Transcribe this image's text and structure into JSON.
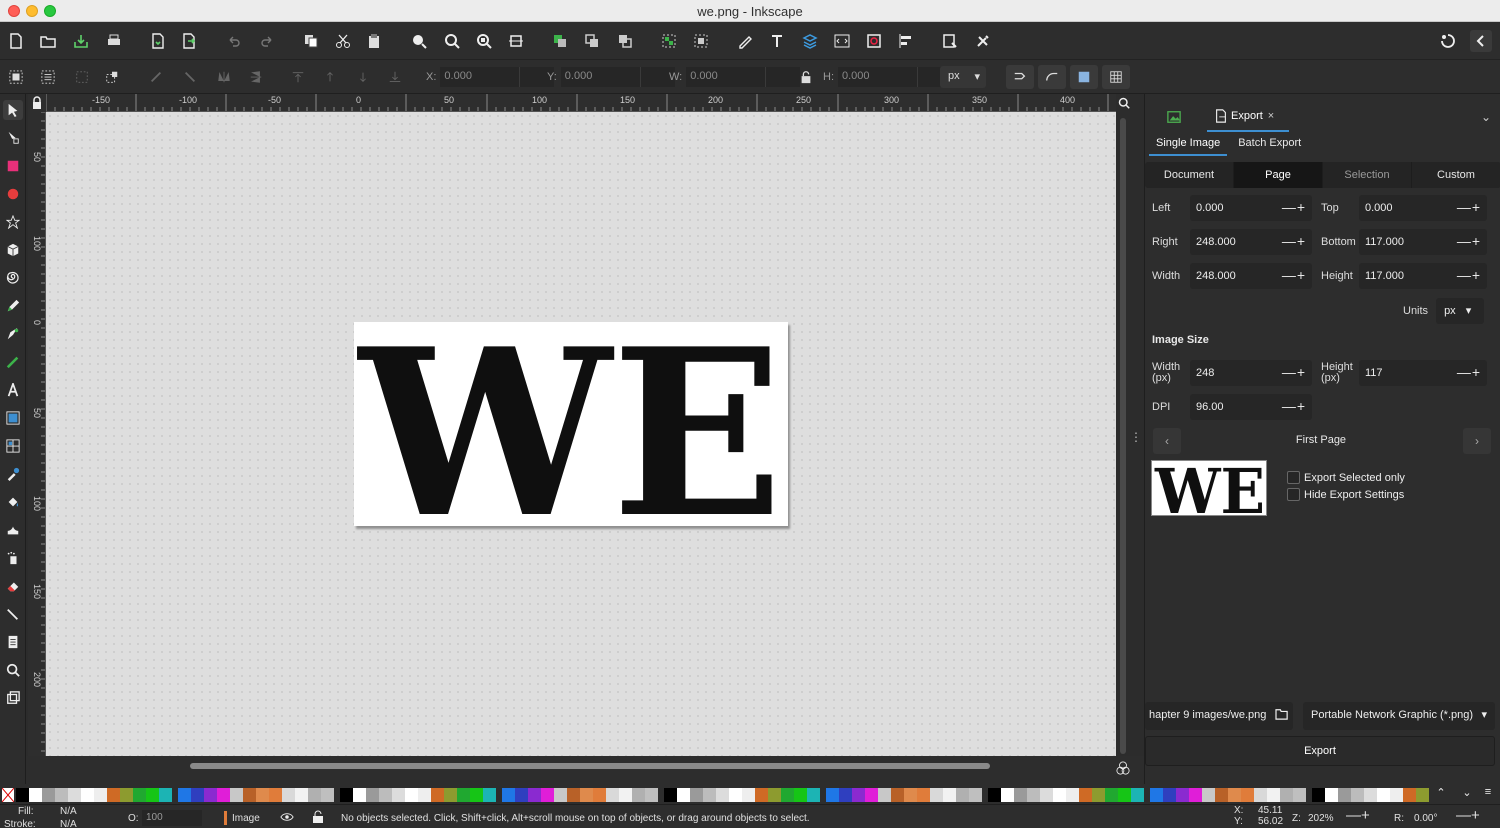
{
  "window": {
    "title": "we.png - Inkscape"
  },
  "toolbar": {
    "icons": [
      "new-document-icon",
      "open-icon",
      "save-icon",
      "print-icon",
      "import-icon",
      "export-icon",
      "undo-icon",
      "redo-icon",
      "copy-icon",
      "cut-icon",
      "paste-icon",
      "zoom-selection-icon",
      "zoom-drawing-icon",
      "zoom-page-icon",
      "zoom-page-width-icon",
      "duplicate-icon",
      "clone-icon",
      "unlink-clone-icon",
      "group-icon",
      "ungroup-icon",
      "fill-stroke-icon",
      "text-font-icon",
      "layers-icon",
      "xml-editor-icon",
      "objects-icon",
      "align-distribute-icon",
      "document-properties-icon",
      "preferences-icon",
      "snap-toggle-icon",
      "collapse-icon"
    ]
  },
  "controls": {
    "x_label": "X:",
    "x_value": "0.000",
    "y_label": "Y:",
    "y_value": "0.000",
    "w_label": "W:",
    "w_value": "0.000",
    "h_label": "H:",
    "h_value": "0.000",
    "unit": "px"
  },
  "ruler": {
    "h_labels": [
      "-150",
      "-100",
      "-50",
      "0",
      "50",
      "100",
      "150",
      "200",
      "250",
      "300",
      "350",
      "400"
    ],
    "v_labels": [
      "50",
      "100",
      "0",
      "50",
      "100",
      "150",
      "200"
    ]
  },
  "canvas": {
    "image_text": "WE"
  },
  "dock": {
    "tab_label": "Export",
    "close_glyph": "×",
    "subtabs": [
      "Single Image",
      "Batch Export"
    ],
    "areas": [
      "Document",
      "Page",
      "Selection",
      "Custom"
    ],
    "active_area": "Page",
    "fields": {
      "left_label": "Left",
      "left_value": "0.000",
      "top_label": "Top",
      "top_value": "0.000",
      "right_label": "Right",
      "right_value": "248.000",
      "bottom_label": "Bottom",
      "bottom_value": "117.000",
      "width_label": "Width",
      "width_value": "248.000",
      "height_label": "Height",
      "height_value": "117.000"
    },
    "units_label": "Units",
    "units_value": "px",
    "image_size_title": "Image Size",
    "img_width_label": "Width (px)",
    "img_width_value": "248",
    "img_height_label": "Height (px)",
    "img_height_value": "117",
    "dpi_label": "DPI",
    "dpi_value": "96.00",
    "page_nav_label": "First Page",
    "thumb_text": "WE",
    "export_selected_label": "Export Selected only",
    "hide_settings_label": "Hide Export Settings",
    "filename": "hapter 9 images/we.png",
    "format": "Portable Network Graphic (*.png)",
    "export_button": "Export",
    "plus_minus": "—+"
  },
  "palette": {
    "colors": [
      "#000000",
      "#ffffff",
      "#9a9a9a",
      "#bcbcbc",
      "#dcdcdc",
      "#ffffff",
      "#eeeeee",
      "#cf6a25",
      "#8d9b2f",
      "#20a830",
      "#16c516",
      "#1cb4b4",
      "#1f77e6",
      "#2f3fbf",
      "#8a2ad0",
      "#e01ed8",
      "#c8c8c8",
      "#b86128",
      "#df8a4c",
      "#e07c3a",
      "#d9d9d9",
      "#f2f2f2",
      "#b0b0b0",
      "#bfbfbf"
    ]
  },
  "status": {
    "fill_label": "Fill:",
    "fill_value": "N/A",
    "stroke_label": "Stroke:",
    "stroke_value": "N/A",
    "opacity_label": "O:",
    "opacity_value": "100",
    "layer_label": "Image",
    "message": "No objects selected. Click, Shift+click, Alt+scroll mouse on top of objects, or drag around objects to select.",
    "x_label": "X:",
    "x_value": "45.11",
    "y_label": "Y:",
    "y_value": "56.02",
    "z_label": "Z:",
    "z_value": "202%",
    "r_label": "R:",
    "r_value": "0.00°"
  }
}
